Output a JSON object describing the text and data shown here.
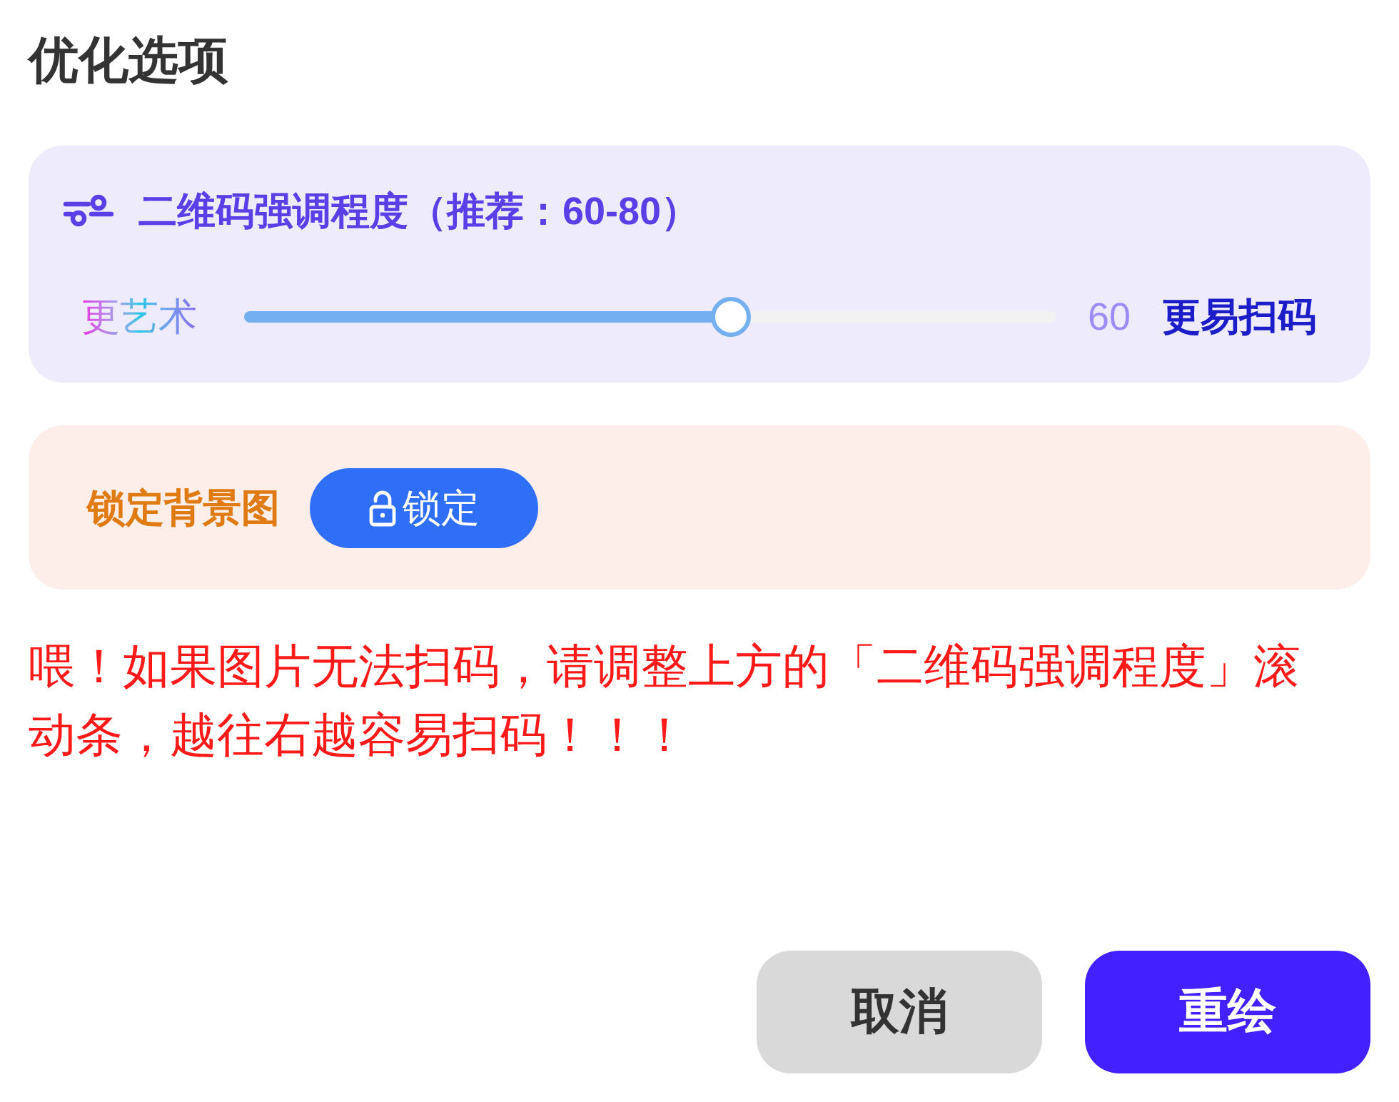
{
  "title": "优化选项",
  "emphasis_card": {
    "heading": "二维码强调程度（推荐：60-80）",
    "slider": {
      "left_label": "更艺术",
      "level": 0.6,
      "reading": "60",
      "right_label": "更易扫码"
    }
  },
  "lock_card": {
    "label": "锁定背景图",
    "button": {
      "label": "锁定",
      "locked": false
    }
  },
  "warning": "喂！如果图片无法扫码，请调整上方的「二维码强调程度」滚动条，越往右越容易扫码！！！",
  "buttons": [
    {
      "label": "取消",
      "kind": "secondary"
    },
    {
      "label": "重绘",
      "kind": "primary"
    }
  ]
}
